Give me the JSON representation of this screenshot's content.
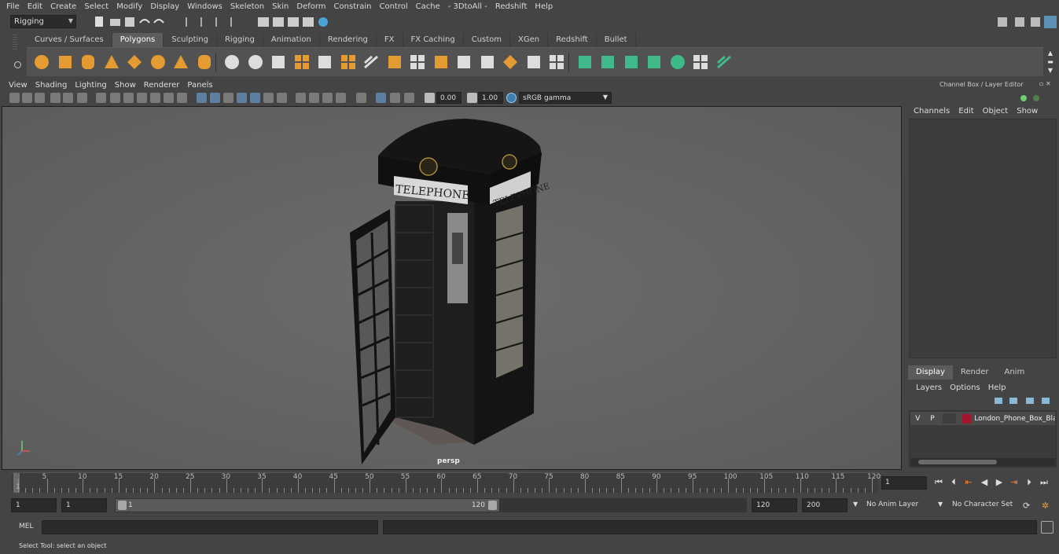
{
  "menu": [
    "File",
    "Edit",
    "Create",
    "Select",
    "Modify",
    "Display",
    "Windows",
    "Skeleton",
    "Skin",
    "Deform",
    "Constrain",
    "Control",
    "Cache",
    "- 3DtoAll -",
    "Redshift",
    "Help"
  ],
  "mode_selector": "Rigging",
  "shelf_tabs": [
    {
      "label": "Curves / Surfaces"
    },
    {
      "label": "Polygons",
      "active": true
    },
    {
      "label": "Sculpting"
    },
    {
      "label": "Rigging"
    },
    {
      "label": "Animation"
    },
    {
      "label": "Rendering"
    },
    {
      "label": "FX"
    },
    {
      "label": "FX Caching"
    },
    {
      "label": "Custom"
    },
    {
      "label": "XGen"
    },
    {
      "label": "Redshift"
    },
    {
      "label": "Bullet"
    }
  ],
  "viewport": {
    "menu": [
      "View",
      "Shading",
      "Lighting",
      "Show",
      "Renderer",
      "Panels"
    ],
    "exposure": "0.00",
    "gamma": "1.00",
    "color_space": "sRGB gamma",
    "camera_label": "persp",
    "sign_text": "TELEPHONE"
  },
  "channel_box": {
    "title": "Channel Box / Layer Editor",
    "menu": [
      "Channels",
      "Edit",
      "Object",
      "Show"
    ]
  },
  "layer_editor": {
    "tabs": [
      {
        "label": "Display",
        "active": true
      },
      {
        "label": "Render"
      },
      {
        "label": "Anim"
      }
    ],
    "menu": [
      "Layers",
      "Options",
      "Help"
    ],
    "layer": {
      "visible": "V",
      "playback": "P",
      "name": "London_Phone_Box_Blac",
      "color": "#a0162c"
    }
  },
  "timeline": {
    "ticks": [
      "5",
      "10",
      "15",
      "20",
      "25",
      "30",
      "35",
      "40",
      "45",
      "50",
      "55",
      "60",
      "65",
      "70",
      "75",
      "80",
      "85",
      "90",
      "95",
      "100",
      "105",
      "110",
      "115",
      "120"
    ],
    "start_marker": "1",
    "current_frame": "1"
  },
  "range": {
    "start": "1",
    "playback_start": "1",
    "slider_start": "1",
    "slider_end": "120",
    "playback_end": "120",
    "end": "200",
    "anim_layer": "No Anim Layer",
    "character_set": "No Character Set"
  },
  "command_line": {
    "label": "MEL"
  },
  "help_line": "Select Tool: select an object",
  "colors": {
    "accent_blue": "#4aa3d8",
    "icon_orange": "#e39b32",
    "icon_green": "#3fb88a",
    "layer_red": "#a0162c"
  }
}
